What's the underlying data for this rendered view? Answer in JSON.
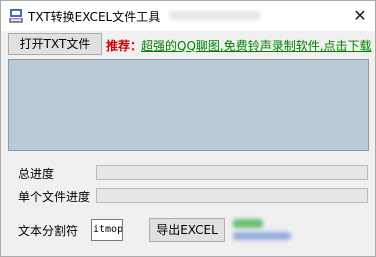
{
  "window": {
    "title": "TXT转换EXCEL文件工具",
    "close_glyph": "✕"
  },
  "toolbar": {
    "open_button_label": "打开TXT文件",
    "recommend_label": "推荐：",
    "recommend_link_text": "超强的QQ聊图,免费铃声录制软件,点击下载"
  },
  "progress": {
    "total_label": "总进度",
    "total_value": 0,
    "single_label": "单个文件进度",
    "single_value": 0
  },
  "separator": {
    "label": "文本分割符",
    "value": "itmop"
  },
  "export": {
    "button_label": "导出EXCEL"
  },
  "colors": {
    "content_area_bg": "#b9c9d6",
    "recommend_red": "#d00000",
    "link_green": "#008000"
  }
}
